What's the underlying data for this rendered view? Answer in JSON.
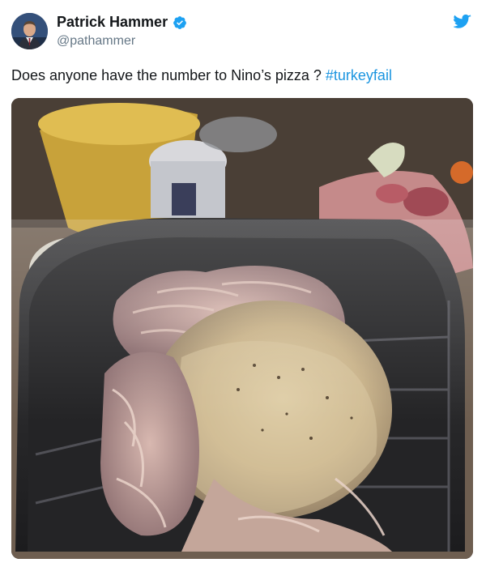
{
  "tweet": {
    "author": {
      "display_name": "Patrick Hammer",
      "handle": "@pathammer",
      "verified": true,
      "avatar_icon": "profile-photo"
    },
    "text": "Does anyone have the number to Nino’s pizza ? ",
    "hashtag": "#turkeyfail",
    "brand_icon": "twitter-bird-icon",
    "colors": {
      "link": "#1b95e0",
      "verified": "#1da1f2",
      "handle": "#657786"
    },
    "media": {
      "type": "photo",
      "subject": "shredded-roast-turkey-in-pan"
    }
  }
}
